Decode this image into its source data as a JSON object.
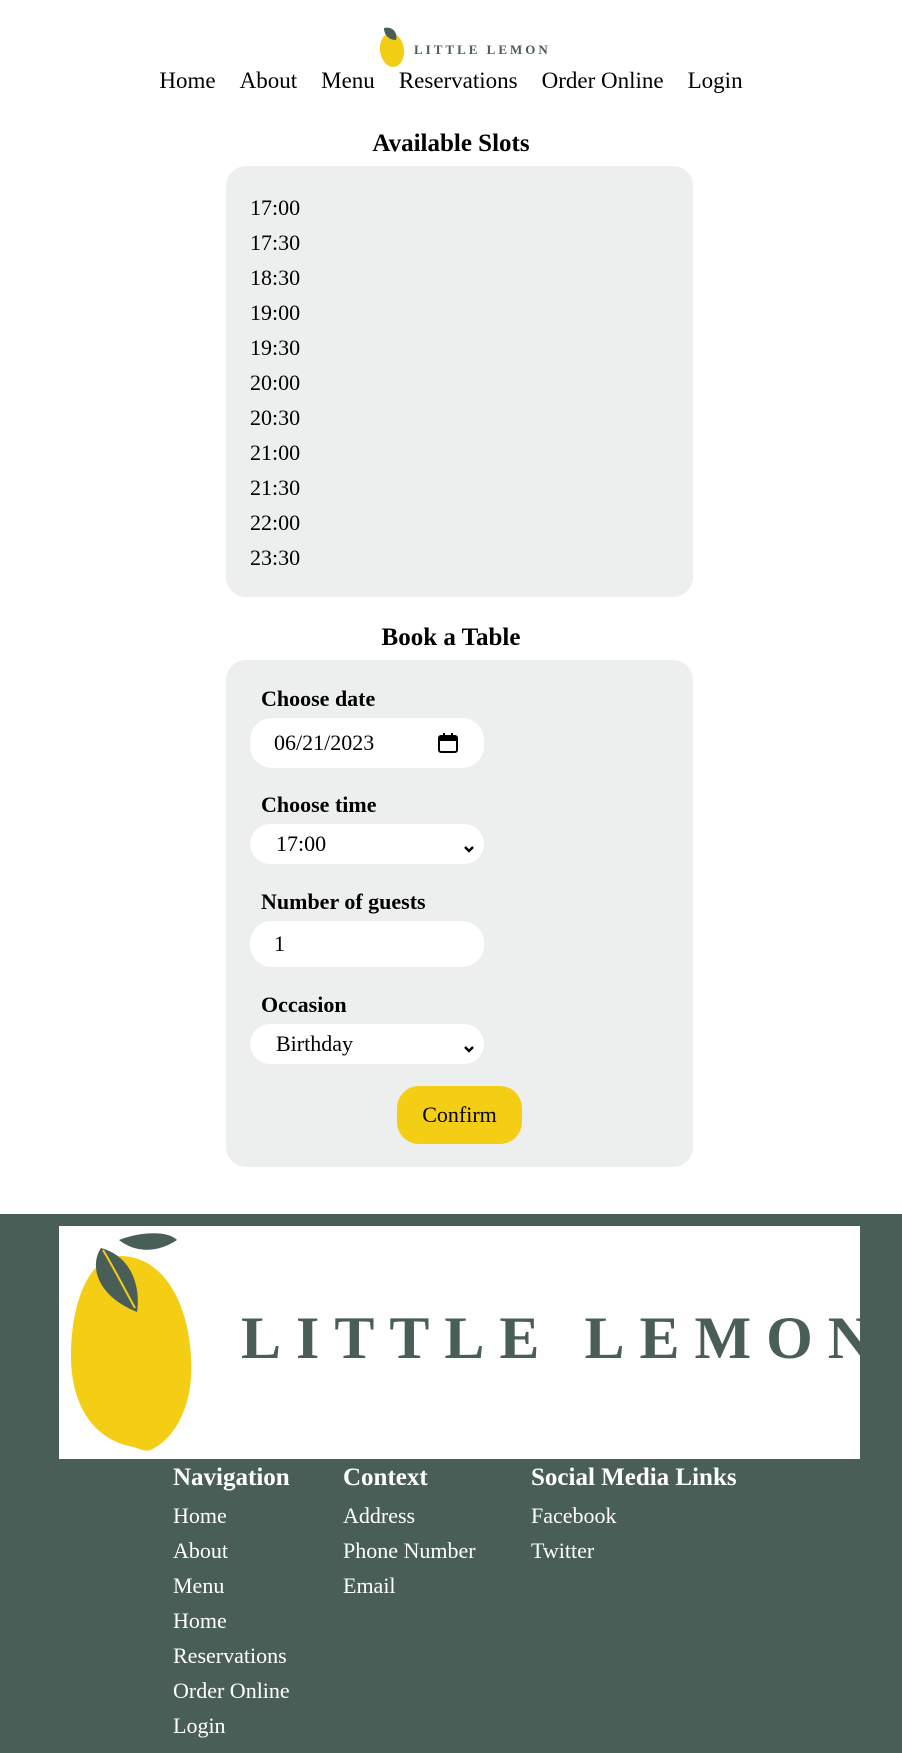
{
  "brand": {
    "name": "LITTLE LEMON",
    "colors": {
      "primary": "#495e57",
      "accent": "#f4ce14",
      "panel": "#edefee",
      "leaf": "#495e57",
      "lemon": "#f4ce14"
    }
  },
  "nav": {
    "items": [
      {
        "label": "Home"
      },
      {
        "label": "About"
      },
      {
        "label": "Menu"
      },
      {
        "label": "Reservations"
      },
      {
        "label": "Order Online"
      },
      {
        "label": "Login"
      }
    ]
  },
  "slots": {
    "title": "Available Slots",
    "times": [
      "17:00",
      "17:30",
      "18:30",
      "19:00",
      "19:30",
      "20:00",
      "20:30",
      "21:00",
      "21:30",
      "22:00",
      "23:30"
    ]
  },
  "booking": {
    "title": "Book a Table",
    "date_label": "Choose date",
    "date_value": "06/21/2023",
    "time_label": "Choose time",
    "time_value": "17:00",
    "guests_label": "Number of guests",
    "guests_value": "1",
    "occasion_label": "Occasion",
    "occasion_value": "Birthday",
    "confirm_label": "Confirm"
  },
  "footer": {
    "logo_text": "LITTLE LEMON",
    "navigation": {
      "title": "Navigation",
      "links": [
        {
          "label": "Home"
        },
        {
          "label": "About"
        },
        {
          "label": "Menu"
        },
        {
          "label": "Home"
        },
        {
          "label": "Reservations"
        },
        {
          "label": "Order Online"
        },
        {
          "label": "Login"
        }
      ]
    },
    "context": {
      "title": "Context",
      "links": [
        {
          "label": "Address"
        },
        {
          "label": "Phone Number"
        },
        {
          "label": "Email"
        }
      ]
    },
    "social": {
      "title": "Social Media Links",
      "links": [
        {
          "label": "Facebook"
        },
        {
          "label": "Twitter"
        }
      ]
    }
  },
  "icons": {
    "logo": "lemon-icon",
    "date_picker": "calendar-icon",
    "select_arrow": "chevron-down-icon"
  }
}
